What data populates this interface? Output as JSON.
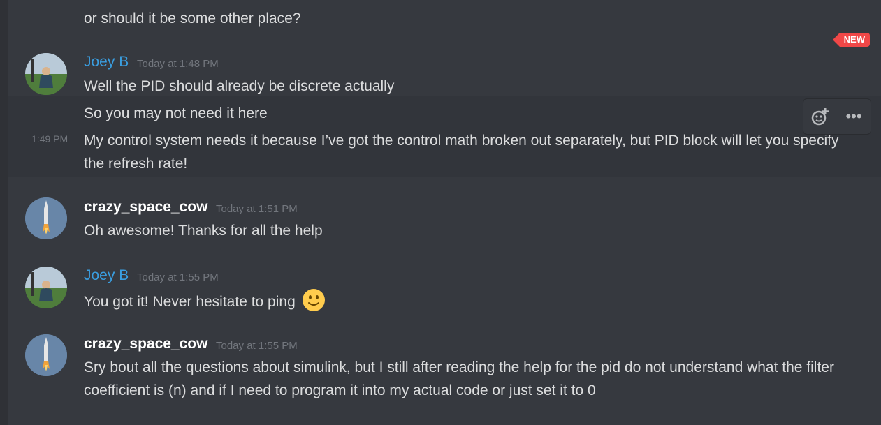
{
  "messages": {
    "prev_line": "or should it be some other place?",
    "new_badge": "NEW",
    "m1": {
      "author": "Joey B",
      "time": "Today at 1:48 PM",
      "lines": [
        "Well the PID should already be discrete actually",
        "So you may not need it here"
      ],
      "side_time": "1:49 PM",
      "long_line": "My control system needs it because I’ve got the control math broken out separately, but PID block will let you specify the refresh rate!"
    },
    "m2": {
      "author": "crazy_space_cow",
      "time": "Today at 1:51 PM",
      "text": "Oh awesome! Thanks for all the help"
    },
    "m3": {
      "author": "Joey B",
      "time": "Today at 1:55 PM",
      "text": "You got it! Never hesitate to ping",
      "emoji": "slightly-smiling-face-icon"
    },
    "m4": {
      "author": "crazy_space_cow",
      "time": "Today at 1:55 PM",
      "text": "Sry bout all the questions about simulink, but I still after reading the help for the pid do not understand what the filter coefficient is (n) and if I need to program it into my actual code or just set it to 0"
    }
  },
  "toolbar": {
    "icons": [
      "add-reaction-icon",
      "more-options-icon"
    ],
    "more_glyph": "•••"
  },
  "colors": {
    "background": "#36393f",
    "hover": "#32353b",
    "new_divider": "#f04747",
    "joey_name": "#3a9ee0",
    "cow_name": "#ffffff",
    "timestamp": "#72767d"
  }
}
